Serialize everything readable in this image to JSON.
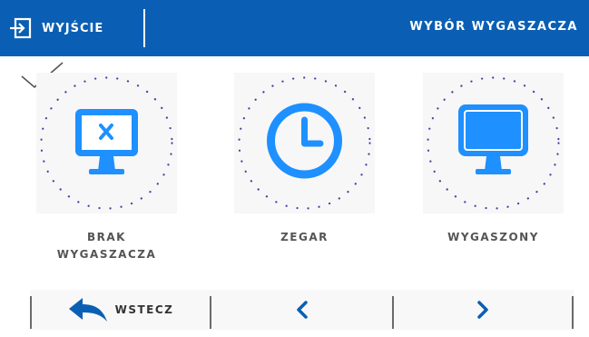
{
  "header": {
    "exit_label": "WYJŚCIE",
    "title": "WYBÓR WYGASZACZA"
  },
  "options": [
    {
      "label": "BRAK\nWYGASZACZA",
      "icon": "monitor-x-icon",
      "selected": true
    },
    {
      "label": "ZEGAR",
      "icon": "clock-icon",
      "selected": false
    },
    {
      "label": "WYGASZONY",
      "icon": "monitor-off-icon",
      "selected": false
    }
  ],
  "footer": {
    "back_label": "WSTECZ",
    "prev_icon": "chevron-left-icon",
    "next_icon": "chevron-right-icon"
  },
  "colors": {
    "header_bg": "#0a5fb4",
    "icon_blue": "#1e90ff",
    "dot_purple": "#4b3fa0"
  }
}
